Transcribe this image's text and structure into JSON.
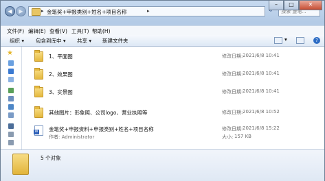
{
  "address": {
    "path": "金笔奖+申报类别+姓名+项目名称",
    "separator": "▸",
    "after": "▸"
  },
  "search": {
    "placeholder": "搜索 金笔..."
  },
  "window_controls": {
    "minimize": "–",
    "maximize": "□",
    "close": "✕"
  },
  "menu": [
    "文件(F)",
    "编辑(E)",
    "查看(V)",
    "工具(T)",
    "帮助(H)"
  ],
  "toolbar": {
    "organize": "组织 ▾",
    "include": "包含到库中 ▾",
    "share": "共享 ▾",
    "new_folder": "新建文件夹"
  },
  "items": [
    {
      "name": "1、平面图",
      "mod_label": "修改日期:",
      "date": "2021/6/8 10:41",
      "type": "folder"
    },
    {
      "name": "2、效果图",
      "mod_label": "修改日期:",
      "date": "2021/6/8 10:41",
      "type": "folder"
    },
    {
      "name": "3、实景图",
      "mod_label": "修改日期:",
      "date": "2021/6/8 10:41",
      "type": "folder"
    },
    {
      "name": "其他图片：形象照、公司logo、营业执照等",
      "mod_label": "修改日期:",
      "date": "2021/6/8 10:52",
      "type": "folder"
    },
    {
      "name": "金笔奖+申报资料+申报类别+姓名+项目名称",
      "mod_label": "修改日期:",
      "date": "2021/6/8 15:22",
      "type": "doc",
      "author": "作者: Administrator",
      "size_label": "大小:",
      "size": "157 KB"
    }
  ],
  "details": {
    "count": "5 个对象"
  }
}
